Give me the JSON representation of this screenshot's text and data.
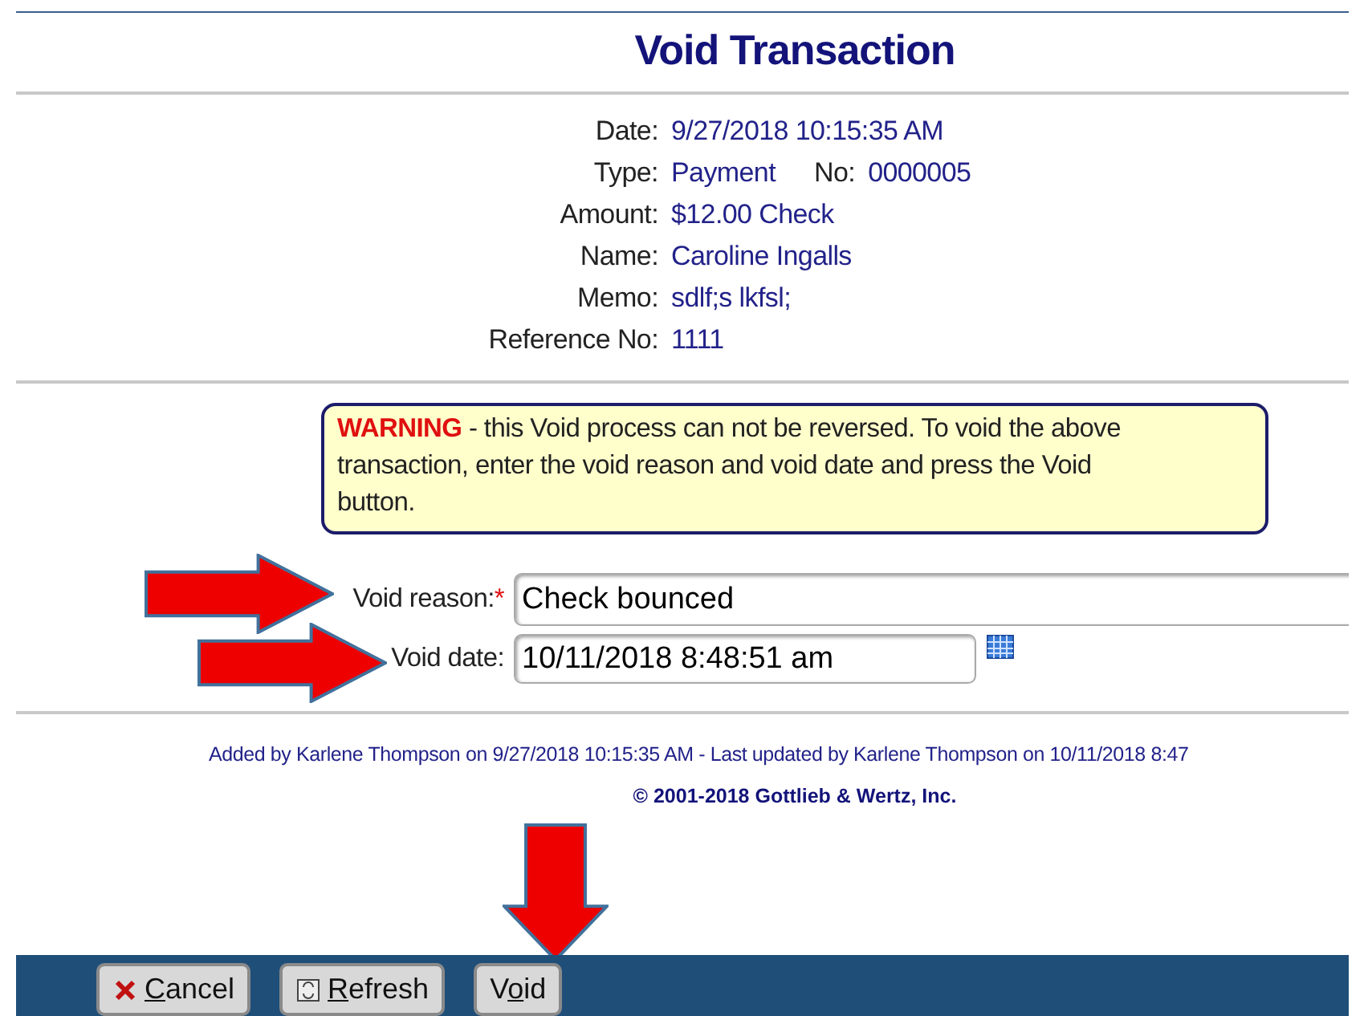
{
  "title": "Void Transaction",
  "details": [
    {
      "label": "Date:",
      "value": "9/27/2018 10:15:35 AM"
    },
    {
      "label": "Type:",
      "value": "Payment",
      "extra_label": "No:",
      "extra_value": "0000005"
    },
    {
      "label": "Amount:",
      "value": "$12.00 Check"
    },
    {
      "label": "Name:",
      "value": "Caroline Ingalls"
    },
    {
      "label": "Memo:",
      "value": "sdlf;s lkfsl;"
    },
    {
      "label": "Reference No:",
      "value": "1111"
    }
  ],
  "warning": {
    "heading": "WARNING",
    "text": " - this Void process can not be reversed. To void the above transaction, enter the void reason and void date and press the Void button."
  },
  "fields": [
    {
      "kind": "reason",
      "label": "Void reason:",
      "required_mark": "*",
      "value": "Check bounced"
    },
    {
      "kind": "date",
      "label": "Void date:",
      "value": "10/11/2018 8:48:51 am"
    }
  ],
  "audit": "Added by Karlene Thompson on 9/27/2018 10:15:35 AM - Last updated by Karlene Thompson on 10/11/2018 8:47",
  "copyright": "© 2001-2018 Gottlieb & Wertz, Inc.",
  "buttons": [
    {
      "kind": "cancel",
      "label": [
        {
          "text": "C",
          "underline": true
        },
        {
          "text": "ancel",
          "underline": false
        }
      ]
    },
    {
      "kind": "refresh",
      "label": [
        {
          "text": "R",
          "underline": true
        },
        {
          "text": "efresh",
          "underline": false
        }
      ]
    },
    {
      "kind": "void",
      "label": [
        {
          "text": "V",
          "underline": false
        },
        {
          "text": "o",
          "underline": true
        },
        {
          "text": "id",
          "underline": false
        }
      ]
    }
  ]
}
